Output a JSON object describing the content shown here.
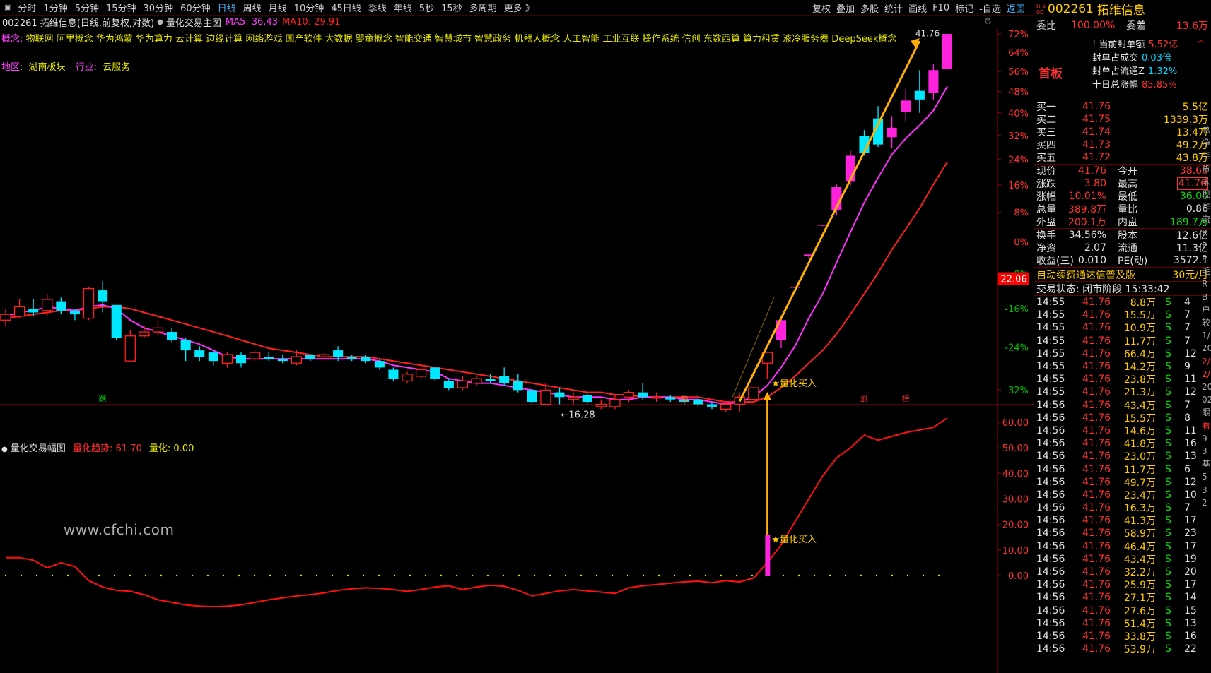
{
  "toolbar": {
    "periods": [
      "分时",
      "1分钟",
      "5分钟",
      "15分钟",
      "30分钟",
      "60分钟",
      "日线",
      "周线",
      "月线",
      "10分钟",
      "45日线",
      "季线",
      "年线",
      "5秒",
      "15秒",
      "多周期"
    ],
    "active": "日线",
    "more": "更多 》",
    "tools": [
      "复权",
      "叠加",
      "多股",
      "统计",
      "画线",
      "F10",
      "标记",
      "-自选",
      "返回"
    ]
  },
  "header": {
    "code_title": "002261 拓维信息(日线,前复权,对数)",
    "indicator": "量化交易主图",
    "ma5": "MA5: 36.43",
    "ma10": "MA10: 29.91"
  },
  "concepts": {
    "label": "概念:",
    "text": "物联网 阿里概念 华为鸿蒙 华为算力 云计算 边缘计算 网络游戏 国产软件 大数据 婴童概念 智能交通 智慧城市 智慧政务 机器人概念 人工智能 工业互联 操作系统 信创 东数西算 算力租赁 液冷服务器 DeepSeek概念"
  },
  "region": {
    "label1": "地区:",
    "value1": "湖南板块",
    "label2": "行业:",
    "value2": "云服务"
  },
  "main_chart": {
    "yaxis_pct": [
      "72%",
      "64%",
      "56%",
      "48%",
      "40%",
      "32%",
      "24%",
      "16%",
      "8%",
      "0%",
      "-8%",
      "-16%",
      "-24%",
      "-32%"
    ],
    "current_price_tag": "22.06",
    "low_label": "←16.28",
    "high_label": "41.76",
    "buy_label": "★量化买入",
    "markers": [
      {
        "t": "跌"
      },
      {
        "t": "预"
      },
      {
        "t": "涨"
      },
      {
        "t": "榜"
      }
    ],
    "candles": [
      [
        19.8,
        20.1,
        19.5,
        20.4
      ],
      [
        20.0,
        20.5,
        19.9,
        20.9
      ],
      [
        20.4,
        20.2,
        20.0,
        20.9
      ],
      [
        20.3,
        20.9,
        20.0,
        21.2
      ],
      [
        20.8,
        20.3,
        20.1,
        21.0
      ],
      [
        20.3,
        20.1,
        19.8,
        20.4
      ],
      [
        19.9,
        21.5,
        19.8,
        21.6
      ],
      [
        21.4,
        20.8,
        20.2,
        21.9
      ],
      [
        20.6,
        18.9,
        18.8,
        20.6
      ],
      [
        17.8,
        19.0,
        17.8,
        19.3
      ],
      [
        19.0,
        19.2,
        18.9,
        19.5
      ],
      [
        19.2,
        19.4,
        19.0,
        19.8
      ],
      [
        19.2,
        18.8,
        18.7,
        19.4
      ],
      [
        18.8,
        18.3,
        17.8,
        18.9
      ],
      [
        18.3,
        18.0,
        17.8,
        18.5
      ],
      [
        18.2,
        17.8,
        17.6,
        18.3
      ],
      [
        17.7,
        18.1,
        17.5,
        18.2
      ],
      [
        18.1,
        17.7,
        17.5,
        18.2
      ],
      [
        17.9,
        18.2,
        17.8,
        18.3
      ],
      [
        18.0,
        17.9,
        17.8,
        18.2
      ],
      [
        17.9,
        17.8,
        17.7,
        18.1
      ],
      [
        17.7,
        18.0,
        17.6,
        18.3
      ],
      [
        18.1,
        17.9,
        17.8,
        18.1
      ],
      [
        18.0,
        18.1,
        17.8,
        18.2
      ],
      [
        18.3,
        18.0,
        17.8,
        18.5
      ],
      [
        18.0,
        17.9,
        17.8,
        18.1
      ],
      [
        18.0,
        17.8,
        17.7,
        18.1
      ],
      [
        17.8,
        17.5,
        17.4,
        17.9
      ],
      [
        17.4,
        17.0,
        16.9,
        17.5
      ],
      [
        16.9,
        17.2,
        16.8,
        17.3
      ],
      [
        17.1,
        17.4,
        17.0,
        17.5
      ],
      [
        17.5,
        17.0,
        16.9,
        17.5
      ],
      [
        16.9,
        16.6,
        16.5,
        17.0
      ],
      [
        16.6,
        16.9,
        16.5,
        17.1
      ],
      [
        16.8,
        17.0,
        16.7,
        17.1
      ],
      [
        17.0,
        16.9,
        16.8,
        17.2
      ],
      [
        17.1,
        16.8,
        16.7,
        17.5
      ],
      [
        16.9,
        16.5,
        16.4,
        17.2
      ],
      [
        16.5,
        16.0,
        15.9,
        16.6
      ],
      [
        15.9,
        16.5,
        15.9,
        16.8
      ],
      [
        16.4,
        16.2,
        15.9,
        16.6
      ],
      [
        16.1,
        16.2,
        15.9,
        16.4
      ],
      [
        16.3,
        16.0,
        15.9,
        16.4
      ],
      [
        15.8,
        15.9,
        15.7,
        16.1
      ],
      [
        15.8,
        16.1,
        15.7,
        16.3
      ],
      [
        16.2,
        16.4,
        16.0,
        16.5
      ],
      [
        16.4,
        16.2,
        16.1,
        16.8
      ],
      [
        16.2,
        16.2,
        16.0,
        16.4
      ],
      [
        16.2,
        16.1,
        16.0,
        16.3
      ],
      [
        16.1,
        16.0,
        15.9,
        16.2
      ],
      [
        16.1,
        15.9,
        15.8,
        16.3
      ],
      [
        15.9,
        15.8,
        15.7,
        16.0
      ],
      [
        15.7,
        15.9,
        15.6,
        16.0
      ],
      [
        15.9,
        16.2,
        15.6,
        16.4
      ],
      [
        16.1,
        16.6,
        16.1,
        16.6
      ],
      [
        17.7,
        18.2,
        17.0,
        18.2
      ],
      [
        18.8,
        19.8,
        18.4,
        19.9
      ],
      [
        21.6,
        21.6,
        21.6,
        21.6
      ],
      [
        23.4,
        23.5,
        23.3,
        23.5
      ],
      [
        25.4,
        25.4,
        25.3,
        25.4
      ],
      [
        26.4,
        28.0,
        26.0,
        28.2
      ],
      [
        28.4,
        30.4,
        28.1,
        30.8
      ],
      [
        32.0,
        30.6,
        30.4,
        32.5
      ],
      [
        33.5,
        31.3,
        31.1,
        34.6
      ],
      [
        31.9,
        32.7,
        31.0,
        33.7
      ],
      [
        34.1,
        35.1,
        33.2,
        36.2
      ],
      [
        36.0,
        35.2,
        34.0,
        38.0
      ],
      [
        35.8,
        38.0,
        35.2,
        38.6
      ],
      [
        38.1,
        41.76,
        38.1,
        41.76
      ]
    ],
    "ma5": [
      20.0,
      20.2,
      20.3,
      20.5,
      20.4,
      20.3,
      20.5,
      20.6,
      20.4,
      19.8,
      19.4,
      19.2,
      19.0,
      18.8,
      18.6,
      18.3,
      18.0,
      17.9,
      17.9,
      17.9,
      17.9,
      17.9,
      17.9,
      17.9,
      17.9,
      17.9,
      17.9,
      17.8,
      17.6,
      17.5,
      17.4,
      17.3,
      17.0,
      16.9,
      16.8,
      16.8,
      16.7,
      16.6,
      16.5,
      16.4,
      16.3,
      16.2,
      16.2,
      16.2,
      16.1,
      16.1,
      16.2,
      16.2,
      16.2,
      16.1,
      16.1,
      16.0,
      15.9,
      16.0,
      16.2,
      16.7,
      17.5,
      18.5,
      19.9,
      21.2,
      23.0,
      24.9,
      26.9,
      28.7,
      30.5,
      31.8,
      32.9,
      34.2,
      36.43
    ],
    "ma10": [
      19.9,
      20.0,
      20.1,
      20.2,
      20.3,
      20.3,
      20.4,
      20.5,
      20.5,
      20.4,
      20.2,
      20.0,
      19.8,
      19.6,
      19.4,
      19.2,
      19.0,
      18.8,
      18.6,
      18.4,
      18.3,
      18.2,
      18.1,
      18.0,
      18.0,
      18.0,
      18.0,
      17.9,
      17.8,
      17.7,
      17.6,
      17.5,
      17.4,
      17.3,
      17.2,
      17.1,
      17.0,
      16.9,
      16.8,
      16.7,
      16.6,
      16.5,
      16.4,
      16.4,
      16.3,
      16.3,
      16.2,
      16.2,
      16.2,
      16.2,
      16.2,
      16.1,
      16.0,
      16.0,
      16.0,
      16.2,
      16.6,
      17.1,
      17.7,
      18.3,
      19.1,
      20.1,
      21.2,
      22.4,
      23.8,
      25.1,
      26.5,
      28.2,
      29.91
    ]
  },
  "sub_chart": {
    "title": "量化交易幅图",
    "trend_label": "量化趋势: 61.70",
    "quant_label": "量化: 0.00",
    "yaxis": [
      "60.00",
      "50.00",
      "40.00",
      "30.00",
      "20.00",
      "10.00",
      "0.00"
    ],
    "buy_label": "★量化买入",
    "trend_values": [
      7.0,
      7.0,
      6.0,
      3.0,
      5.0,
      3.5,
      -2.0,
      -4.5,
      -5.8,
      -6.2,
      -7.5,
      -9.5,
      -10.5,
      -11.5,
      -12.0,
      -12.2,
      -12.0,
      -11.5,
      -10.5,
      -9.5,
      -8.8,
      -8.0,
      -7.5,
      -6.8,
      -5.8,
      -5.2,
      -4.8,
      -5.0,
      -5.5,
      -6.2,
      -5.5,
      -4.5,
      -4.0,
      -5.5,
      -4.5,
      -3.8,
      -4.2,
      -5.8,
      -8.0,
      -7.0,
      -6.0,
      -5.5,
      -6.0,
      -6.5,
      -7.0,
      -4.8,
      -4.0,
      -3.5,
      -3.0,
      -2.5,
      -2.2,
      -2.8,
      -2.0,
      -2.5,
      -1.0,
      5.0,
      12.0,
      21.0,
      30.0,
      39.0,
      46.0,
      50.0,
      55.0,
      53.0,
      54.5,
      56.0,
      57.0,
      58.0,
      61.7
    ],
    "watermark": "www.cfchi.com"
  },
  "right_panel": {
    "code": "002261",
    "name": "拓维信息",
    "badge": "R 500",
    "weibi_label": "委比",
    "weibi_value": "100.00%",
    "weicha_label": "委差",
    "weicha_value": "13.6万",
    "shouban": "首板",
    "feng": [
      {
        "label": "当前封单额",
        "value": "5.52亿"
      },
      {
        "label": "封单占成交",
        "value": "0.03倍"
      },
      {
        "label": "封单占流通Z",
        "value": "1.32%"
      },
      {
        "label": "十日总涨幅",
        "value": "85.85%"
      }
    ],
    "bids": [
      {
        "label": "买一",
        "price": "41.76",
        "vol": "5.5亿"
      },
      {
        "label": "买二",
        "price": "41.75",
        "vol": "1339.3万"
      },
      {
        "label": "买三",
        "price": "41.74",
        "vol": "13.4万"
      },
      {
        "label": "买四",
        "price": "41.73",
        "vol": "49.2万"
      },
      {
        "label": "买五",
        "price": "41.72",
        "vol": "43.8万"
      }
    ],
    "quote": [
      {
        "l1": "现价",
        "v1": "41.76",
        "l2": "今开",
        "v2": "38.60"
      },
      {
        "l1": "涨跌",
        "v1": "3.80",
        "l2": "最高",
        "v2": "41.76"
      },
      {
        "l1": "涨幅",
        "v1": "10.01%",
        "l2": "最低",
        "v2": "36.00"
      },
      {
        "l1": "总量",
        "v1": "389.8万",
        "l2": "量比",
        "v2": "0.86"
      },
      {
        "l1": "外盘",
        "v1": "200.1万",
        "l2": "内盘",
        "v2": "189.7万"
      }
    ],
    "quote2": [
      {
        "l1": "换手",
        "v1": "34.56%",
        "l2": "股本",
        "v2": "12.6亿"
      },
      {
        "l1": "净资",
        "v1": "2.07",
        "l2": "流通",
        "v2": "11.3亿"
      },
      {
        "l1": "收益(三)",
        "v1": "0.010",
        "l2": "PE(动)",
        "v2": "3572.1"
      }
    ],
    "promo": "自动续费通达信普及版",
    "promo_price": "30元/月",
    "status": "交易状态: 闭市阶段 15:33:42",
    "ticks": [
      [
        "14:55",
        "41.76",
        "8.8万",
        "S",
        "4"
      ],
      [
        "14:55",
        "41.76",
        "15.5万",
        "S",
        "7"
      ],
      [
        "14:55",
        "41.76",
        "10.9万",
        "S",
        "7"
      ],
      [
        "14:55",
        "41.76",
        "11.7万",
        "S",
        "7"
      ],
      [
        "14:55",
        "41.76",
        "66.4万",
        "S",
        "12"
      ],
      [
        "14:55",
        "41.76",
        "14.2万",
        "S",
        "9"
      ],
      [
        "14:55",
        "41.76",
        "23.8万",
        "S",
        "11"
      ],
      [
        "14:55",
        "41.76",
        "21.3万",
        "S",
        "12"
      ],
      [
        "14:56",
        "41.76",
        "43.4万",
        "S",
        "7"
      ],
      [
        "14:56",
        "41.76",
        "15.5万",
        "S",
        "8"
      ],
      [
        "14:56",
        "41.76",
        "14.6万",
        "S",
        "11"
      ],
      [
        "14:56",
        "41.76",
        "41.8万",
        "S",
        "16"
      ],
      [
        "14:56",
        "41.76",
        "23.0万",
        "S",
        "13"
      ],
      [
        "14:56",
        "41.76",
        "11.7万",
        "S",
        "6"
      ],
      [
        "14:56",
        "41.76",
        "49.7万",
        "S",
        "12"
      ],
      [
        "14:56",
        "41.76",
        "23.4万",
        "S",
        "10"
      ],
      [
        "14:56",
        "41.76",
        "16.3万",
        "S",
        "7"
      ],
      [
        "14:56",
        "41.76",
        "41.3万",
        "S",
        "17"
      ],
      [
        "14:56",
        "41.76",
        "58.9万",
        "S",
        "23"
      ],
      [
        "14:56",
        "41.76",
        "46.4万",
        "S",
        "17"
      ],
      [
        "14:56",
        "41.76",
        "43.4万",
        "S",
        "19"
      ],
      [
        "14:56",
        "41.76",
        "32.2万",
        "S",
        "20"
      ],
      [
        "14:56",
        "41.76",
        "25.9万",
        "S",
        "17"
      ],
      [
        "14:56",
        "41.76",
        "27.1万",
        "S",
        "14"
      ],
      [
        "14:56",
        "41.76",
        "27.6万",
        "S",
        "15"
      ],
      [
        "14:56",
        "41.76",
        "51.4万",
        "S",
        "13"
      ],
      [
        "14:56",
        "41.76",
        "33.8万",
        "S",
        "16"
      ],
      [
        "14:56",
        "41.76",
        "53.9万",
        "S",
        "22"
      ]
    ],
    "edge": [
      "总",
      "净",
      "非",
      "货",
      "未",
      "现",
      "非",
      "资",
      "R",
      "P",
      "P",
      "毛",
      "R",
      "B",
      "户",
      "较",
      "1/",
      "20",
      "2/",
      "2/",
      "20",
      "02",
      "眼",
      "看",
      "9",
      "3",
      "基",
      "5",
      "3",
      "2"
    ]
  }
}
